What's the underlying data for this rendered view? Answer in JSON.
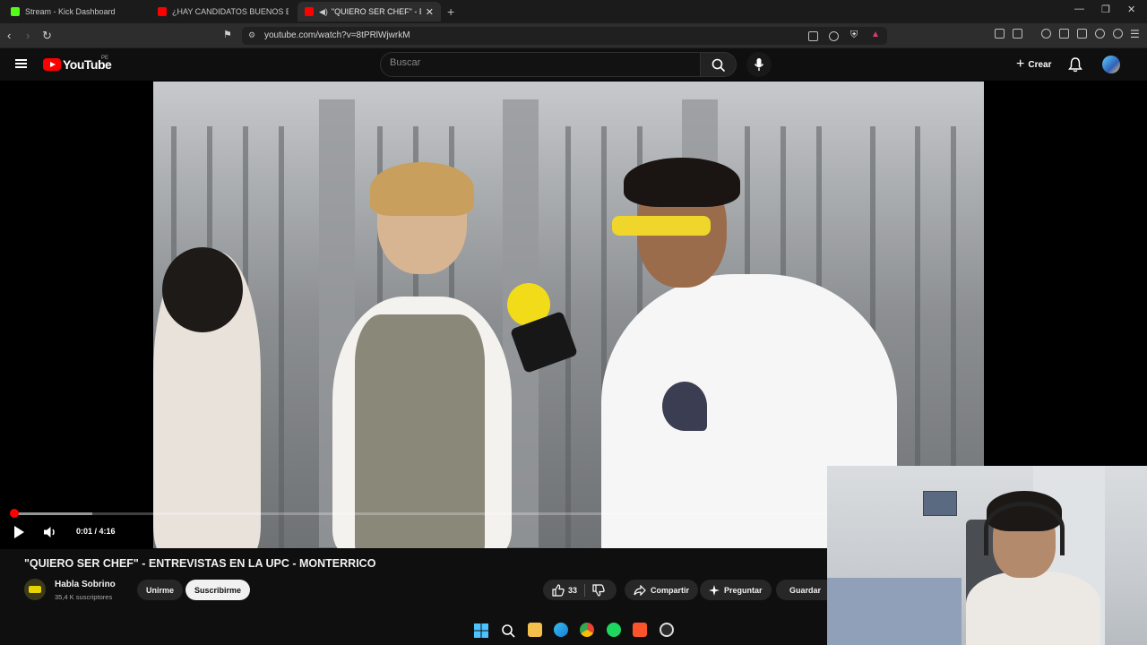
{
  "browser": {
    "tabs": [
      {
        "label": "Stream - Kick Dashboard",
        "favicon_color": "#53fc18"
      },
      {
        "label": "¿HAY CANDIDATOS BUENOS EN PERÚ",
        "favicon_color": "#ff0000"
      },
      {
        "label": "\"QUIERO SER CHEF\" - ENTREVISTAS",
        "favicon_color": "#ff0000",
        "active": true
      }
    ],
    "url": "youtube.com/watch?v=8tPRlWjwrkM"
  },
  "youtube": {
    "logo_text": "YouTube",
    "country_code": "PE",
    "search_placeholder": "Buscar",
    "create_label": "Crear"
  },
  "player": {
    "time_display": "0:01 / 4:16",
    "played_fraction": 0.004,
    "buffered_fraction": 0.1,
    "accent_color": "#ff0000"
  },
  "video": {
    "title": "\"QUIERO SER CHEF\" - ENTREVISTAS EN LA UPC - MONTERRICO",
    "channel_name": "Habla Sobrino",
    "subscribers": "35,4 K suscriptores",
    "join_label": "Unirme",
    "subscribe_label": "Suscribirme",
    "like_count": "33",
    "share_label": "Compartir",
    "ask_label": "Preguntar",
    "save_label": "Guardar"
  },
  "taskbar": {
    "icons": [
      "windows-start-icon",
      "search-icon",
      "file-explorer-icon",
      "edge-icon",
      "chrome-icon",
      "spotify-icon",
      "brave-icon",
      "obs-icon"
    ]
  }
}
